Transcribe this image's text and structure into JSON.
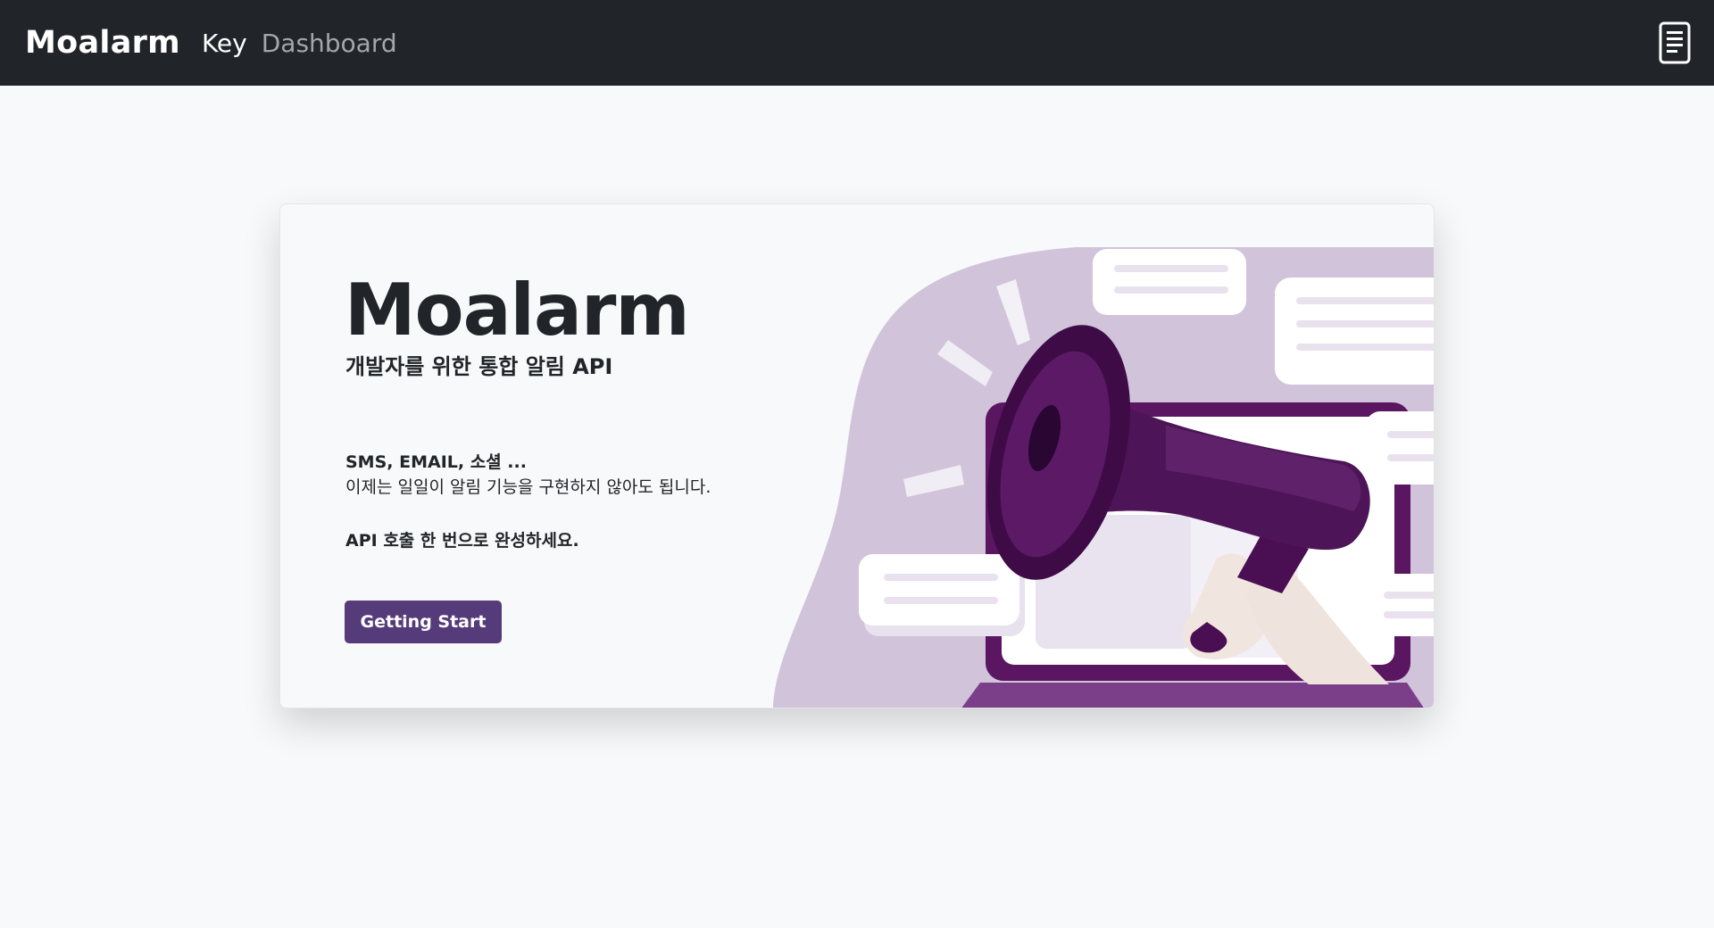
{
  "navbar": {
    "brand": "Moalarm",
    "links": [
      {
        "label": "Key"
      },
      {
        "label": "Dashboard"
      }
    ],
    "right_icon": "document-icon"
  },
  "hero": {
    "title": "Moalarm",
    "subtitle": "개발자를 위한 통합 알림 API",
    "line1": "SMS, EMAIL, 소셜 ...",
    "line2": "이제는 일일이 알림 기능을 구현하지 않아도 됩니다.",
    "line3": "API 호출 한 번으로 완성하세요.",
    "cta_label": "Getting Start",
    "illustration_icon": "megaphone-illustration"
  },
  "colors": {
    "navbar_bg": "#212529",
    "accent": "#563b7a",
    "page_bg": "#f8f9fa"
  }
}
